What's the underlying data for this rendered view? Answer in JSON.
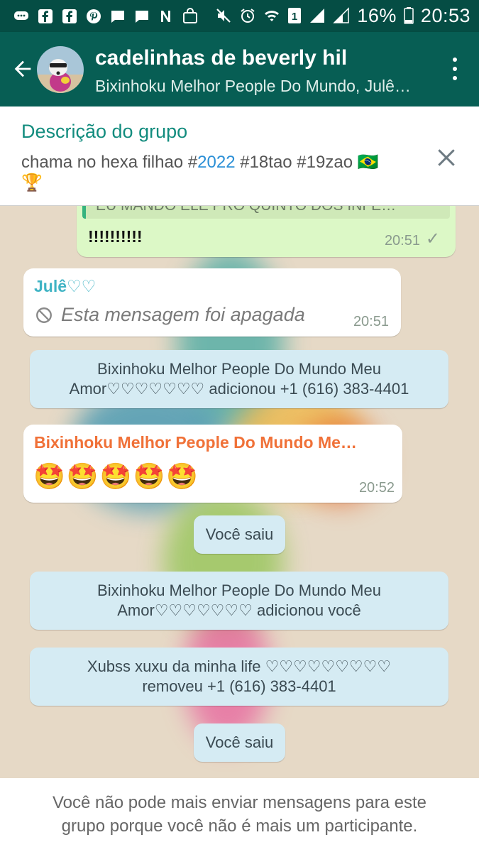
{
  "status_bar": {
    "battery": "16%",
    "time": "20:53",
    "sim_badge": "1",
    "left_icons": [
      "chat-bubble-icon",
      "facebook-icon",
      "facebook-icon",
      "pinterest-icon",
      "message-icon",
      "message-icon",
      "n-icon",
      "bag-icon"
    ],
    "right_icons": [
      "mute-icon",
      "alarm-icon",
      "wifi-icon",
      "sim-icon",
      "signal-icon",
      "signal-icon",
      "battery-icon"
    ]
  },
  "header": {
    "title": "cadelinhas de beverly hil",
    "subtitle": "Bixinhoku Melhor People Do Mundo, Julê…"
  },
  "group_description": {
    "title": "Descrição do grupo",
    "text_before": "chama no hexa filhao #",
    "hashtag_year": "2022",
    "text_after": " #18tao #19zao 🇧🇷",
    "text_line2": "🏆"
  },
  "messages": [
    {
      "kind": "outgoing",
      "quote_text": "EU MANDO ELE PRO QUINTO DOS INFE…",
      "text": "!!!!!!!!!!",
      "time": "20:51",
      "status": "✓"
    },
    {
      "kind": "incoming",
      "sender": "Julê♡♡",
      "deleted_text": "Esta mensagem foi apagada",
      "time": "20:51"
    },
    {
      "kind": "system",
      "line1": "Bixinhoku Melhor People Do Mundo Meu",
      "line2": "Amor♡♡♡♡♡♡♡ adicionou +1 (616) 383-4401"
    },
    {
      "kind": "incoming",
      "sender": "Bixinhoku Melhor People Do Mundo Me…",
      "emoji": "🤩🤩🤩🤩🤩",
      "time": "20:52"
    },
    {
      "kind": "system",
      "text": "Você saiu"
    },
    {
      "kind": "system",
      "line1": "Bixinhoku Melhor People Do Mundo Meu",
      "line2": "Amor♡♡♡♡♡♡♡ adicionou você"
    },
    {
      "kind": "system",
      "line1": "Xubss xuxu da minha life ♡♡♡♡♡♡♡♡♡",
      "line2": "removeu +1 (616) 383-4401"
    },
    {
      "kind": "system",
      "text": "Você saiu"
    }
  ],
  "footer": {
    "line1": "Você não pode mais enviar mensagens para este",
    "line2": "grupo porque você não é mais um participante."
  },
  "colors": {
    "status_bar": "#054d44",
    "app_bar": "#075e54",
    "accent": "#128c7e",
    "hashtag": "#2b8fd6",
    "sender_1": "#3fb3c4",
    "sender_2": "#f07138",
    "outgoing_bubble": "#dcf8c6",
    "system_bubble": "#d5ebf3"
  }
}
